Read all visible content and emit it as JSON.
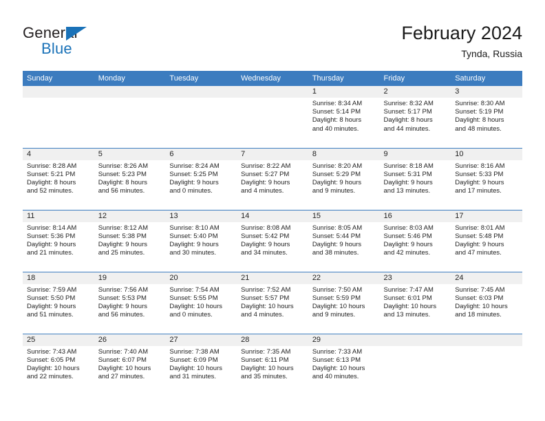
{
  "logo": {
    "primary_text": "General",
    "secondary_text": "Blue",
    "primary_color": "#231f20",
    "accent_color": "#1a72b8",
    "mark": "triangle-mark"
  },
  "header": {
    "title": "February 2024",
    "subtitle": "Tynda, Russia"
  },
  "theme": {
    "header_blue": "#3c7cbf",
    "daynum_band": "#f0f0f0",
    "text": "#222222",
    "page_background": "#ffffff"
  },
  "calendar": {
    "weekday_headers": [
      "Sunday",
      "Monday",
      "Tuesday",
      "Wednesday",
      "Thursday",
      "Friday",
      "Saturday"
    ],
    "labels": {
      "sunrise": "Sunrise:",
      "sunset": "Sunset:",
      "daylight": "Daylight:"
    },
    "weeks": [
      [
        {
          "day": "",
          "empty": true
        },
        {
          "day": "",
          "empty": true
        },
        {
          "day": "",
          "empty": true
        },
        {
          "day": "",
          "empty": true
        },
        {
          "day": "1",
          "sunrise": "Sunrise: 8:34 AM",
          "sunset": "Sunset: 5:14 PM",
          "daylight_line1": "Daylight: 8 hours",
          "daylight_line2": "and 40 minutes."
        },
        {
          "day": "2",
          "sunrise": "Sunrise: 8:32 AM",
          "sunset": "Sunset: 5:17 PM",
          "daylight_line1": "Daylight: 8 hours",
          "daylight_line2": "and 44 minutes."
        },
        {
          "day": "3",
          "sunrise": "Sunrise: 8:30 AM",
          "sunset": "Sunset: 5:19 PM",
          "daylight_line1": "Daylight: 8 hours",
          "daylight_line2": "and 48 minutes."
        }
      ],
      [
        {
          "day": "4",
          "sunrise": "Sunrise: 8:28 AM",
          "sunset": "Sunset: 5:21 PM",
          "daylight_line1": "Daylight: 8 hours",
          "daylight_line2": "and 52 minutes."
        },
        {
          "day": "5",
          "sunrise": "Sunrise: 8:26 AM",
          "sunset": "Sunset: 5:23 PM",
          "daylight_line1": "Daylight: 8 hours",
          "daylight_line2": "and 56 minutes."
        },
        {
          "day": "6",
          "sunrise": "Sunrise: 8:24 AM",
          "sunset": "Sunset: 5:25 PM",
          "daylight_line1": "Daylight: 9 hours",
          "daylight_line2": "and 0 minutes."
        },
        {
          "day": "7",
          "sunrise": "Sunrise: 8:22 AM",
          "sunset": "Sunset: 5:27 PM",
          "daylight_line1": "Daylight: 9 hours",
          "daylight_line2": "and 4 minutes."
        },
        {
          "day": "8",
          "sunrise": "Sunrise: 8:20 AM",
          "sunset": "Sunset: 5:29 PM",
          "daylight_line1": "Daylight: 9 hours",
          "daylight_line2": "and 9 minutes."
        },
        {
          "day": "9",
          "sunrise": "Sunrise: 8:18 AM",
          "sunset": "Sunset: 5:31 PM",
          "daylight_line1": "Daylight: 9 hours",
          "daylight_line2": "and 13 minutes."
        },
        {
          "day": "10",
          "sunrise": "Sunrise: 8:16 AM",
          "sunset": "Sunset: 5:33 PM",
          "daylight_line1": "Daylight: 9 hours",
          "daylight_line2": "and 17 minutes."
        }
      ],
      [
        {
          "day": "11",
          "sunrise": "Sunrise: 8:14 AM",
          "sunset": "Sunset: 5:36 PM",
          "daylight_line1": "Daylight: 9 hours",
          "daylight_line2": "and 21 minutes."
        },
        {
          "day": "12",
          "sunrise": "Sunrise: 8:12 AM",
          "sunset": "Sunset: 5:38 PM",
          "daylight_line1": "Daylight: 9 hours",
          "daylight_line2": "and 25 minutes."
        },
        {
          "day": "13",
          "sunrise": "Sunrise: 8:10 AM",
          "sunset": "Sunset: 5:40 PM",
          "daylight_line1": "Daylight: 9 hours",
          "daylight_line2": "and 30 minutes."
        },
        {
          "day": "14",
          "sunrise": "Sunrise: 8:08 AM",
          "sunset": "Sunset: 5:42 PM",
          "daylight_line1": "Daylight: 9 hours",
          "daylight_line2": "and 34 minutes."
        },
        {
          "day": "15",
          "sunrise": "Sunrise: 8:05 AM",
          "sunset": "Sunset: 5:44 PM",
          "daylight_line1": "Daylight: 9 hours",
          "daylight_line2": "and 38 minutes."
        },
        {
          "day": "16",
          "sunrise": "Sunrise: 8:03 AM",
          "sunset": "Sunset: 5:46 PM",
          "daylight_line1": "Daylight: 9 hours",
          "daylight_line2": "and 42 minutes."
        },
        {
          "day": "17",
          "sunrise": "Sunrise: 8:01 AM",
          "sunset": "Sunset: 5:48 PM",
          "daylight_line1": "Daylight: 9 hours",
          "daylight_line2": "and 47 minutes."
        }
      ],
      [
        {
          "day": "18",
          "sunrise": "Sunrise: 7:59 AM",
          "sunset": "Sunset: 5:50 PM",
          "daylight_line1": "Daylight: 9 hours",
          "daylight_line2": "and 51 minutes."
        },
        {
          "day": "19",
          "sunrise": "Sunrise: 7:56 AM",
          "sunset": "Sunset: 5:53 PM",
          "daylight_line1": "Daylight: 9 hours",
          "daylight_line2": "and 56 minutes."
        },
        {
          "day": "20",
          "sunrise": "Sunrise: 7:54 AM",
          "sunset": "Sunset: 5:55 PM",
          "daylight_line1": "Daylight: 10 hours",
          "daylight_line2": "and 0 minutes."
        },
        {
          "day": "21",
          "sunrise": "Sunrise: 7:52 AM",
          "sunset": "Sunset: 5:57 PM",
          "daylight_line1": "Daylight: 10 hours",
          "daylight_line2": "and 4 minutes."
        },
        {
          "day": "22",
          "sunrise": "Sunrise: 7:50 AM",
          "sunset": "Sunset: 5:59 PM",
          "daylight_line1": "Daylight: 10 hours",
          "daylight_line2": "and 9 minutes."
        },
        {
          "day": "23",
          "sunrise": "Sunrise: 7:47 AM",
          "sunset": "Sunset: 6:01 PM",
          "daylight_line1": "Daylight: 10 hours",
          "daylight_line2": "and 13 minutes."
        },
        {
          "day": "24",
          "sunrise": "Sunrise: 7:45 AM",
          "sunset": "Sunset: 6:03 PM",
          "daylight_line1": "Daylight: 10 hours",
          "daylight_line2": "and 18 minutes."
        }
      ],
      [
        {
          "day": "25",
          "sunrise": "Sunrise: 7:43 AM",
          "sunset": "Sunset: 6:05 PM",
          "daylight_line1": "Daylight: 10 hours",
          "daylight_line2": "and 22 minutes."
        },
        {
          "day": "26",
          "sunrise": "Sunrise: 7:40 AM",
          "sunset": "Sunset: 6:07 PM",
          "daylight_line1": "Daylight: 10 hours",
          "daylight_line2": "and 27 minutes."
        },
        {
          "day": "27",
          "sunrise": "Sunrise: 7:38 AM",
          "sunset": "Sunset: 6:09 PM",
          "daylight_line1": "Daylight: 10 hours",
          "daylight_line2": "and 31 minutes."
        },
        {
          "day": "28",
          "sunrise": "Sunrise: 7:35 AM",
          "sunset": "Sunset: 6:11 PM",
          "daylight_line1": "Daylight: 10 hours",
          "daylight_line2": "and 35 minutes."
        },
        {
          "day": "29",
          "sunrise": "Sunrise: 7:33 AM",
          "sunset": "Sunset: 6:13 PM",
          "daylight_line1": "Daylight: 10 hours",
          "daylight_line2": "and 40 minutes."
        },
        {
          "day": "",
          "empty": true
        },
        {
          "day": "",
          "empty": true
        }
      ]
    ]
  }
}
